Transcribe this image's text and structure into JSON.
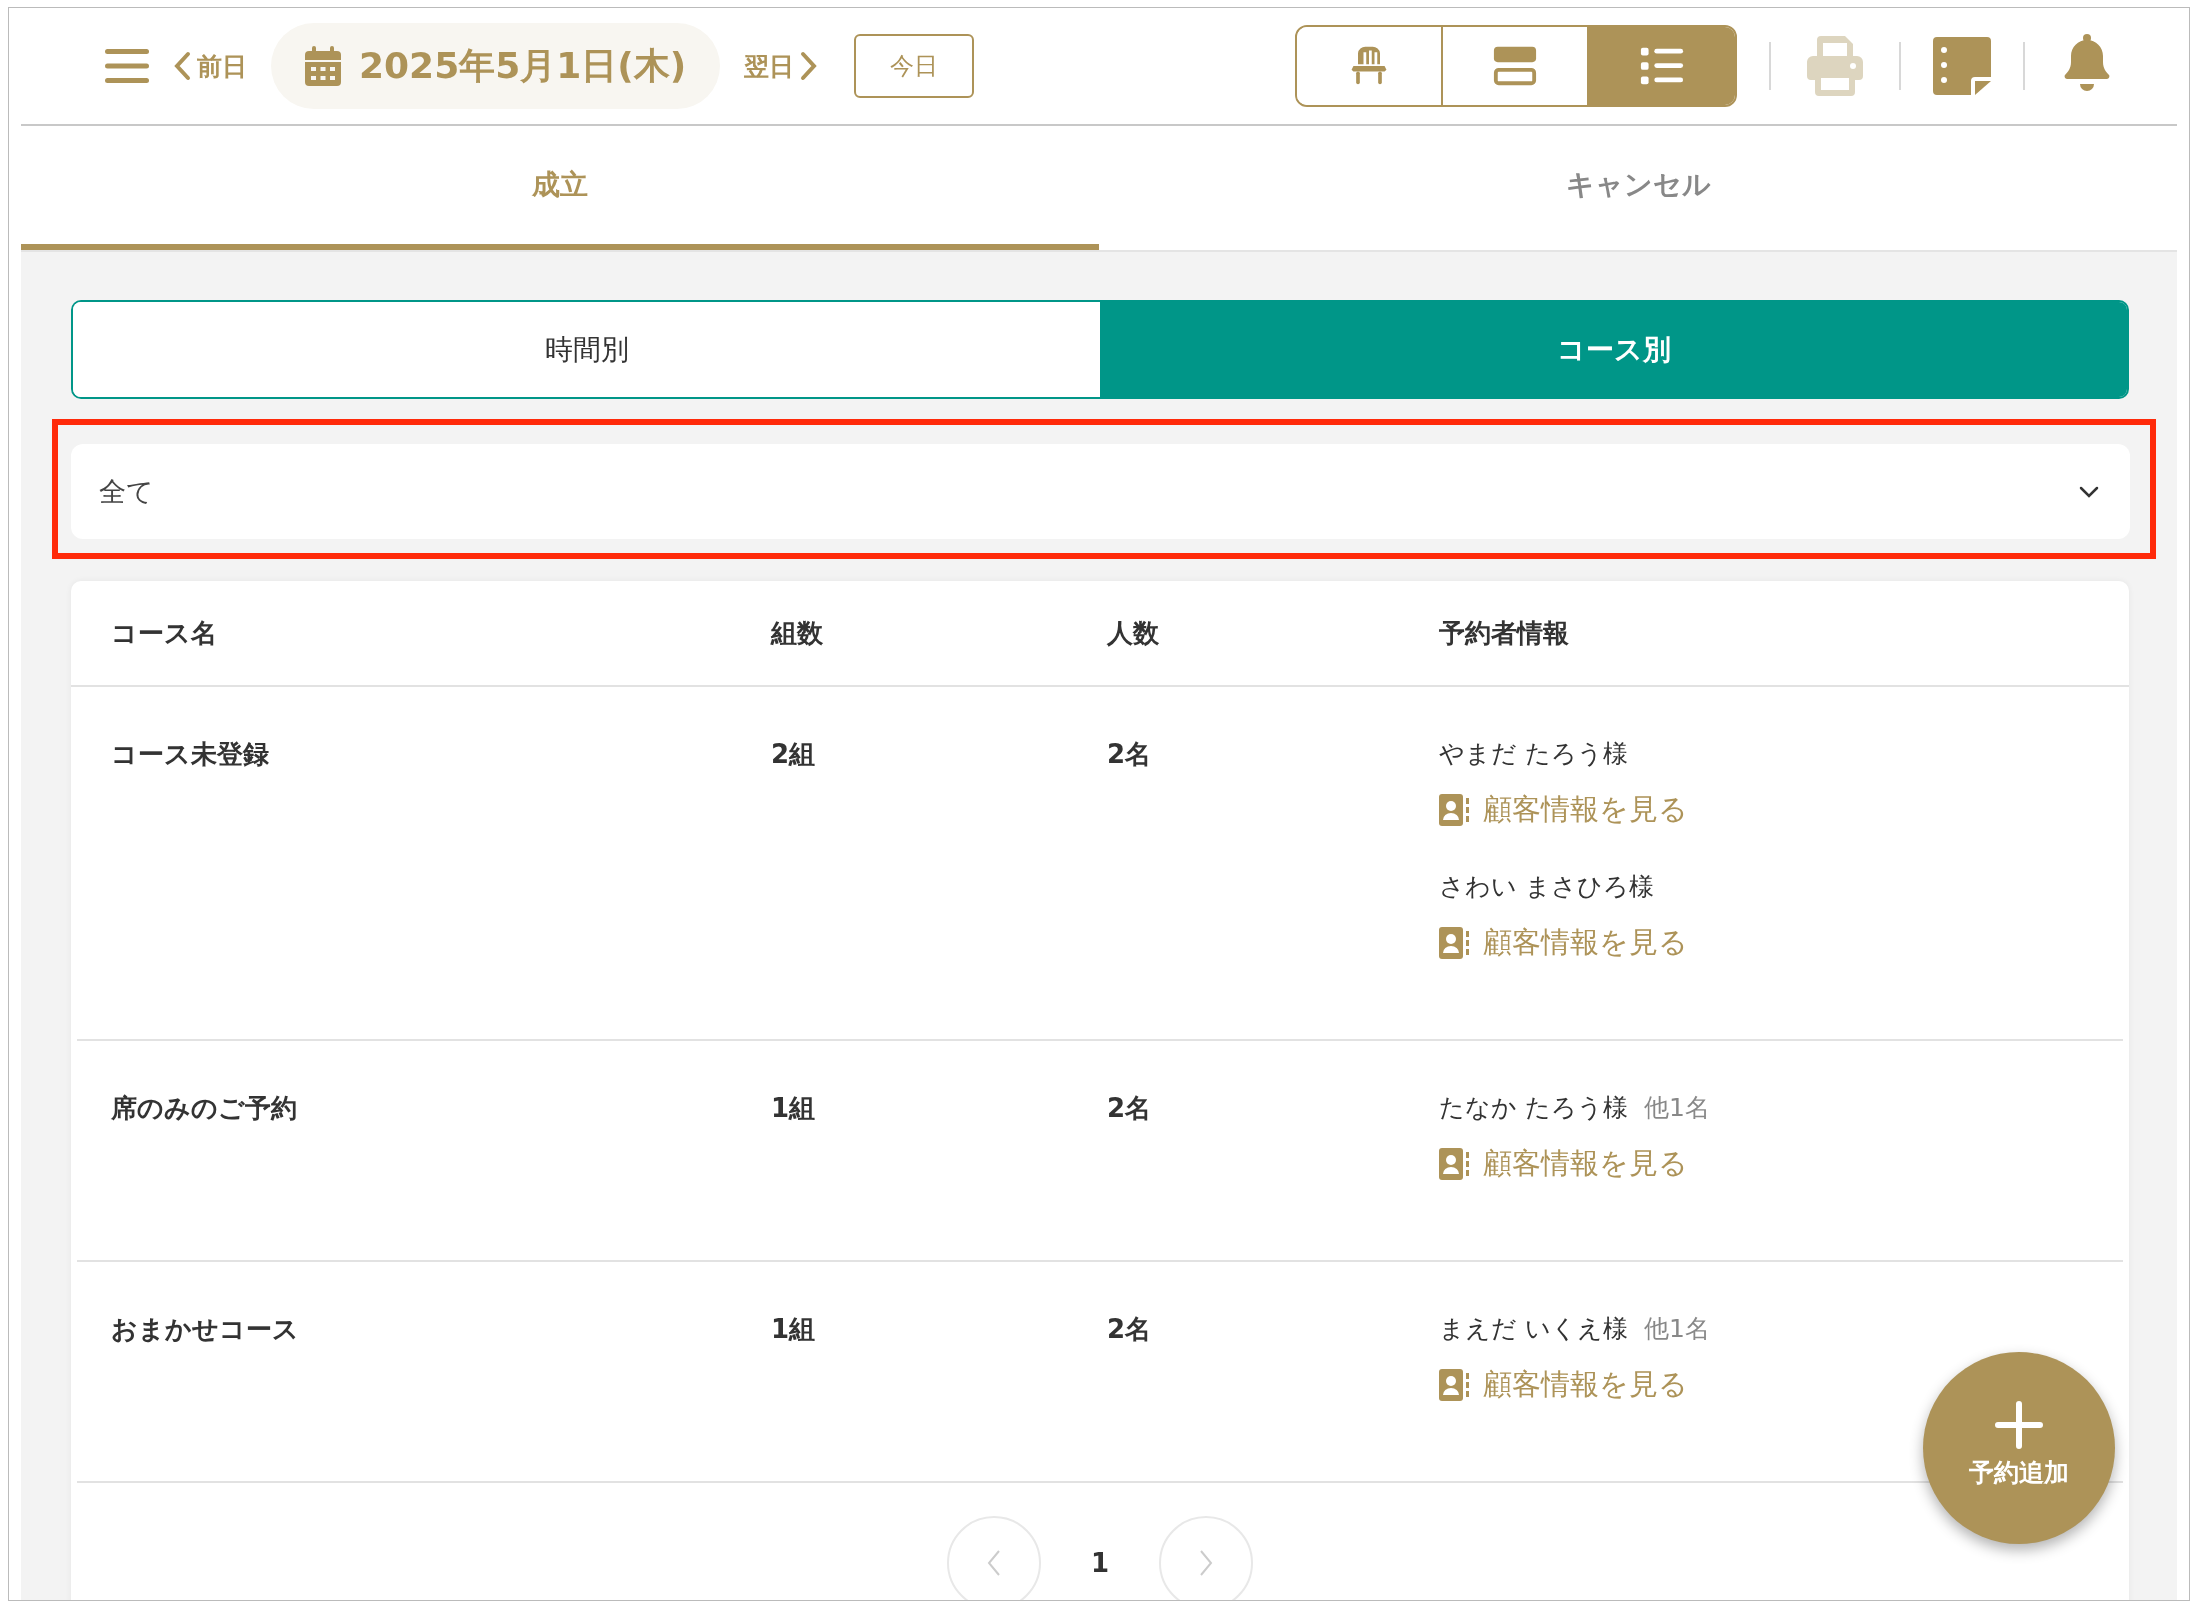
{
  "header": {
    "prev_label": "前日",
    "date": "2025年5月1日(木)",
    "next_label": "翌日",
    "today_button": "今日",
    "view_modes": [
      {
        "kind": "seat",
        "selected": false
      },
      {
        "kind": "timeline",
        "selected": false
      },
      {
        "kind": "list",
        "selected": true
      }
    ],
    "print": {
      "disabled": true
    }
  },
  "tabs": [
    {
      "label": "成立",
      "selected": true
    },
    {
      "label": "キャンセル",
      "selected": false
    }
  ],
  "segments": [
    {
      "label": "時間別",
      "selected": false
    },
    {
      "label": "コース別",
      "selected": true
    }
  ],
  "course_filter": {
    "value": "全て"
  },
  "table": {
    "columns": [
      "コース名",
      "組数",
      "人数",
      "予約者情報"
    ],
    "rows": [
      {
        "course": "コース未登録",
        "groups": "2組",
        "people": "2名",
        "reservers": [
          {
            "name": "やまだ たろう様",
            "link": "顧客情報を見る"
          },
          {
            "name": "さわい まさひろ様",
            "link": "顧客情報を見る"
          }
        ]
      },
      {
        "course": "席のみのご予約",
        "groups": "1組",
        "people": "2名",
        "reservers": [
          {
            "name": "たなか たろう様",
            "others": "他1名",
            "link": "顧客情報を見る"
          }
        ]
      },
      {
        "course": "おまかせコース",
        "groups": "1組",
        "people": "2名",
        "reservers": [
          {
            "name": "まえだ いくえ様",
            "others": "他1名",
            "link": "顧客情報を見る"
          }
        ]
      }
    ]
  },
  "pagination": {
    "page": "1"
  },
  "fab": {
    "label": "予約追加"
  }
}
